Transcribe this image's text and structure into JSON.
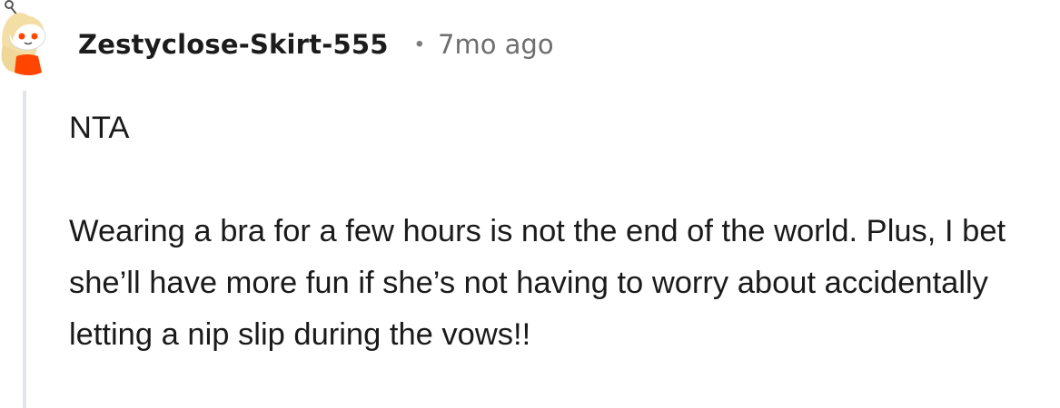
{
  "comment": {
    "username": "Zestyclose-Skirt-555",
    "separator": "•",
    "timestamp": "7mo ago",
    "body": {
      "verdict": "NTA",
      "paragraph": "Wearing a bra for a few hours is not the end of the world. Plus, I bet she’ll have more fun if she’s not having to worry about accidentally letting a nip slip during the vows!!"
    },
    "avatar_icon": "snoo-avatar-icon",
    "colors": {
      "username": "#1c1c1c",
      "timestamp": "#6e6e6e",
      "body_text": "#1a1a1b",
      "thread_line": "#e3e5e8",
      "avatar_hair": "#f3dfa6",
      "avatar_outfit": "#ff4500"
    }
  }
}
